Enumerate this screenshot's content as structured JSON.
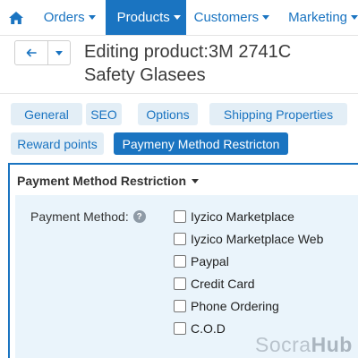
{
  "nav": {
    "home_icon": "home-icon",
    "items": [
      {
        "label": "Orders"
      },
      {
        "label": "Products"
      },
      {
        "label": "Customers"
      },
      {
        "label": "Marketing"
      }
    ],
    "accent_color": "#1a74c1"
  },
  "header": {
    "back_icon": "arrow-left-icon",
    "title": "Editing product:3M 2741C Safety Glasees"
  },
  "tabs": [
    {
      "label": "General"
    },
    {
      "label": "SEO"
    },
    {
      "label": "Options"
    },
    {
      "label": "Shipping Properties"
    },
    {
      "label": "Reward points"
    },
    {
      "label": "Paymeny Method Restricton",
      "active": true
    }
  ],
  "section": {
    "title": "Payment Method Restriction",
    "field_label": "Payment Method:",
    "help_icon": "question-icon",
    "options": [
      {
        "label": "Iyzico Marketplace",
        "checked": false
      },
      {
        "label": "Iyzico Marketplace Web",
        "checked": false
      },
      {
        "label": "Paypal",
        "checked": false
      },
      {
        "label": "Credit Card",
        "checked": false
      },
      {
        "label": "Phone Ordering",
        "checked": false
      },
      {
        "label": "C.O.D",
        "checked": false
      }
    ]
  },
  "watermark": {
    "part1": "Socra",
    "part2": "Hub"
  }
}
